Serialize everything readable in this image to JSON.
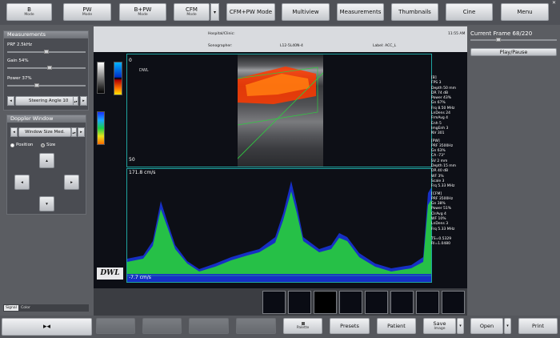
{
  "toolbar": {
    "mode_b": {
      "label": "B",
      "sub": "Mode"
    },
    "mode_pw": {
      "label": "PW",
      "sub": "Mode"
    },
    "mode_bpw": {
      "label": "B+PW",
      "sub": "Mode"
    },
    "mode_cfm": {
      "label": "CFM",
      "sub": "Mode"
    },
    "dropdown": "▾",
    "cfm_pw": "CFM+PW Mode",
    "multiview": "Multiview",
    "measurements": "Measurements",
    "thumbnails": "Thumbnails",
    "cine": "Cine",
    "menu": "Menu"
  },
  "window_close": "✕",
  "left": {
    "measurements_title": "Measurements",
    "prf": "PRF 2.5kHz",
    "prf_level": 0.5,
    "gain": "Gain 54%",
    "gain_level": 0.54,
    "power": "Power 37%",
    "power_level": 0.37,
    "steering": "Steering Angle 10",
    "doppler_title": "Doppler Window",
    "window_size": "Window Size Med.",
    "position": "Position",
    "size": "Size",
    "position_selected": true,
    "tab_signal": "Signal",
    "tab_color": "Color"
  },
  "header": {
    "hospital": "Hospital/Clinic:",
    "time": "11:55 AM",
    "sonographer": "Sonographer:",
    "probe": "L12-5L40N-4",
    "label": "Label:  ACC_L"
  },
  "bmode": {
    "depth_top": "0",
    "depth_bottom": "50",
    "orientation_mark": "DWL"
  },
  "doppler": {
    "vmax": "171.8 cm/s",
    "vmin": "-7.7 cm/s"
  },
  "logo": "DWL",
  "params": {
    "b_head": "[B]",
    "b": [
      "FPS 3",
      "Depth 50 mm",
      "DR 74 dB",
      "Power 43%",
      "Gn 67%",
      "Frq 8.50 MHz",
      "LnDens 24",
      "FrmAvg 4",
      "Enh 5",
      "ImgEnh 3",
      "NV 301"
    ],
    "pw_head": "[PW]",
    "pw": [
      "PRF 3500Hz",
      "Gn 63%",
      "CA -73°",
      "SV 2 mm",
      "Depth 15 mm",
      "DR 40 dB",
      "WF 3%",
      "Scale 3",
      "Frq 5.33 MHz"
    ],
    "cfm_head": "[CFM]",
    "cfm": [
      "PRF 3500Hz",
      "Gn 38%",
      "Power 51%",
      "ClrAvg 4",
      "WF 10%",
      "LnDens 3",
      "Frq 5.33 MHz"
    ],
    "ts": "TS=0.5329",
    "ri": "RI=1.0480"
  },
  "right": {
    "current_frame": "Current Frame 68/220",
    "frame_fraction": 0.309,
    "play_pause": "Play/Pause"
  },
  "bottom": {
    "play_toggle": "▸◂",
    "palette": "Palette",
    "presets": "Presets",
    "patient": "Patient",
    "save": "Save",
    "save_sub": "Image",
    "dropdown": "▾",
    "open": "Open",
    "print": "Print"
  },
  "colors": {
    "flow": "#ff3a00",
    "spectrum": "#28d03a",
    "spectrum_core": "#1a3bff",
    "cursor": "#2ecc40",
    "tissue": "#6d6d70"
  }
}
